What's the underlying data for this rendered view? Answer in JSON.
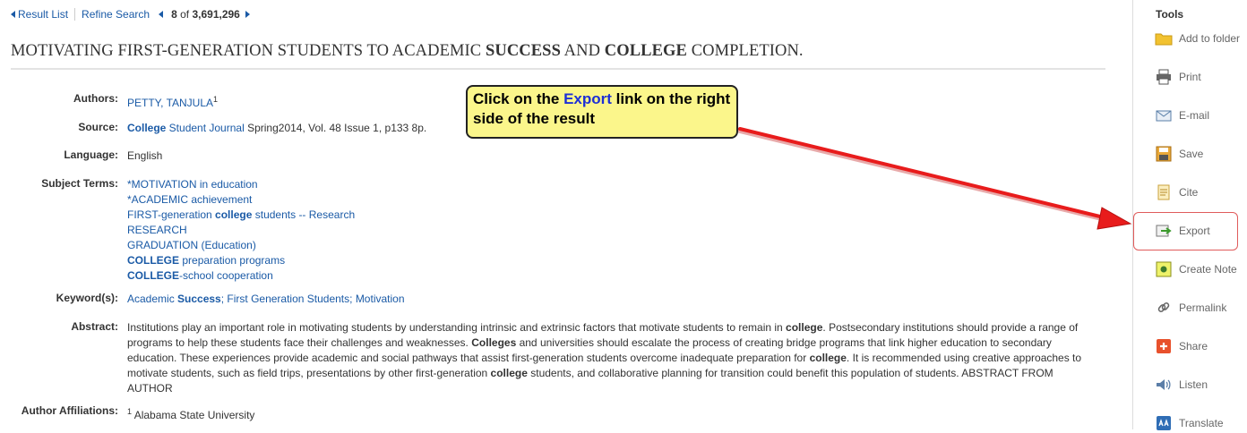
{
  "nav": {
    "result_list": "Result List",
    "refine_search": "Refine Search",
    "position": "8",
    "of": "of",
    "total": "3,691,296"
  },
  "record": {
    "title_parts": [
      "MOTIVATING FIRST-GENERATION STUDENTS TO ACADEMIC ",
      "SUCCESS",
      " AND ",
      "COLLEGE",
      " COMPLETION."
    ],
    "authors_label": "Authors:",
    "author": "PETTY, TANJULA",
    "author_sup": "1",
    "source_label": "Source:",
    "source_link_bold": "College",
    "source_link_rest": " Student Journal",
    "source_rest": " Spring2014, Vol. 48 Issue 1, p133 8p.",
    "language_label": "Language:",
    "language": "English",
    "subject_label": "Subject Terms:",
    "subjects": {
      "s1": "*MOTIVATION in education",
      "s2": "*ACADEMIC achievement",
      "s3a": "FIRST-generation ",
      "s3b": "college",
      "s3c": " students -- Research",
      "s4": "RESEARCH",
      "s5": "GRADUATION (Education)",
      "s6a": "COLLEGE",
      "s6b": " preparation programs",
      "s7a": "COLLEGE",
      "s7b": "-school cooperation"
    },
    "keywords_label": "Keyword(s):",
    "keywords": {
      "k1a": "Academic ",
      "k1b": "Success",
      "sep1": "; ",
      "k2": "First Generation Students",
      "sep2": "; ",
      "k3": "Motivation"
    },
    "abstract_label": "Abstract:",
    "abstract": {
      "p1": "Institutions play an important role in motivating students by understanding intrinsic and extrinsic factors that motivate students to remain in ",
      "b1": "college",
      "p2": ". Postsecondary institutions should provide a range of programs to help these students face their challenges and weaknesses. ",
      "b2": "Colleges",
      "p3": " and universities should escalate the process of creating bridge programs that link higher education to secondary education. These experiences provide academic and social pathways that assist first-generation students overcome inadequate preparation for ",
      "b3": "college",
      "p4": ". It is recommended using creative approaches to motivate students, such as field trips, presentations by other first-generation ",
      "b4": "college",
      "p5": " students, and collaborative planning for transition could benefit this population of students. ABSTRACT FROM AUTHOR"
    },
    "affiliations_label": "Author Affiliations:",
    "affiliation_sup": "1",
    "affiliation": " Alabama State University"
  },
  "callout": {
    "t1": "Click on the ",
    "kw": "Export",
    "t2": " link on the right side of the result"
  },
  "tools": {
    "header": "Tools",
    "items": [
      {
        "label": "Add to folder",
        "icon": "folder-icon"
      },
      {
        "label": "Print",
        "icon": "printer-icon"
      },
      {
        "label": "E-mail",
        "icon": "email-icon"
      },
      {
        "label": "Save",
        "icon": "save-icon"
      },
      {
        "label": "Cite",
        "icon": "cite-icon"
      },
      {
        "label": "Export",
        "icon": "export-icon"
      },
      {
        "label": "Create Note",
        "icon": "note-icon"
      },
      {
        "label": "Permalink",
        "icon": "link-icon"
      },
      {
        "label": "Share",
        "icon": "share-icon"
      },
      {
        "label": "Listen",
        "icon": "speaker-icon"
      },
      {
        "label": "Translate",
        "icon": "translate-icon"
      }
    ]
  },
  "colors": {
    "link": "#1a5aa6",
    "callout_bg": "#fbf68b",
    "callout_keyword": "#1d2fd6",
    "arrow": "#e81c1c",
    "highlight_border": "#e05b5b"
  }
}
